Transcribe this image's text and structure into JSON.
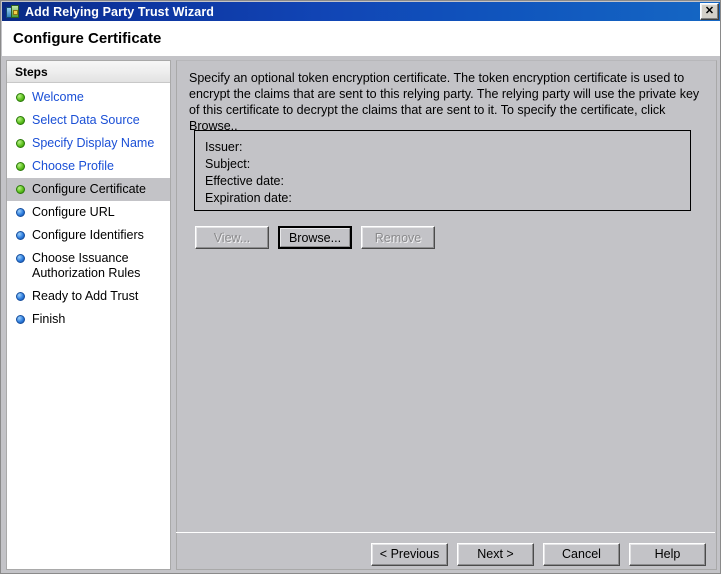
{
  "window": {
    "title": "Add Relying Party Trust Wizard",
    "icon": "wizard-icon",
    "close_label": "✕"
  },
  "header": {
    "title": "Configure Certificate"
  },
  "sidebar": {
    "heading": "Steps",
    "items": [
      {
        "label": "Welcome",
        "state": "done",
        "bullet": "green"
      },
      {
        "label": "Select Data Source",
        "state": "done",
        "bullet": "green"
      },
      {
        "label": "Specify Display Name",
        "state": "done",
        "bullet": "green"
      },
      {
        "label": "Choose Profile",
        "state": "done",
        "bullet": "green"
      },
      {
        "label": "Configure Certificate",
        "state": "current",
        "bullet": "green"
      },
      {
        "label": "Configure URL",
        "state": "upcoming",
        "bullet": "blue"
      },
      {
        "label": "Configure Identifiers",
        "state": "upcoming",
        "bullet": "blue"
      },
      {
        "label": "Choose Issuance Authorization Rules",
        "state": "upcoming",
        "bullet": "blue"
      },
      {
        "label": "Ready to Add Trust",
        "state": "upcoming",
        "bullet": "blue"
      },
      {
        "label": "Finish",
        "state": "upcoming",
        "bullet": "blue"
      }
    ]
  },
  "main": {
    "instructions": "Specify an optional token encryption certificate.  The token encryption certificate is used to encrypt the claims that are sent to this relying party.  The relying party will use the private key of this certificate to decrypt the claims that are sent to it.  To specify the certificate, click Browse..",
    "certificate": {
      "issuer_label": "Issuer:",
      "issuer_value": "",
      "subject_label": "Subject:",
      "subject_value": "",
      "effective_date_label": "Effective date:",
      "effective_date_value": "",
      "expiration_date_label": "Expiration date:",
      "expiration_date_value": ""
    },
    "cert_buttons": {
      "view": "View...",
      "browse": "Browse...",
      "remove": "Remove"
    }
  },
  "footer": {
    "previous": "< Previous",
    "next": "Next >",
    "cancel": "Cancel",
    "help": "Help"
  },
  "colors": {
    "title_bar_start": "#0a2a84",
    "title_bar_end": "#1567c4",
    "dialog_face": "#c3c3c7",
    "link_text": "#1a4fd6",
    "bullet_done": "#5fc21f",
    "bullet_upcoming": "#2f7fe0"
  }
}
